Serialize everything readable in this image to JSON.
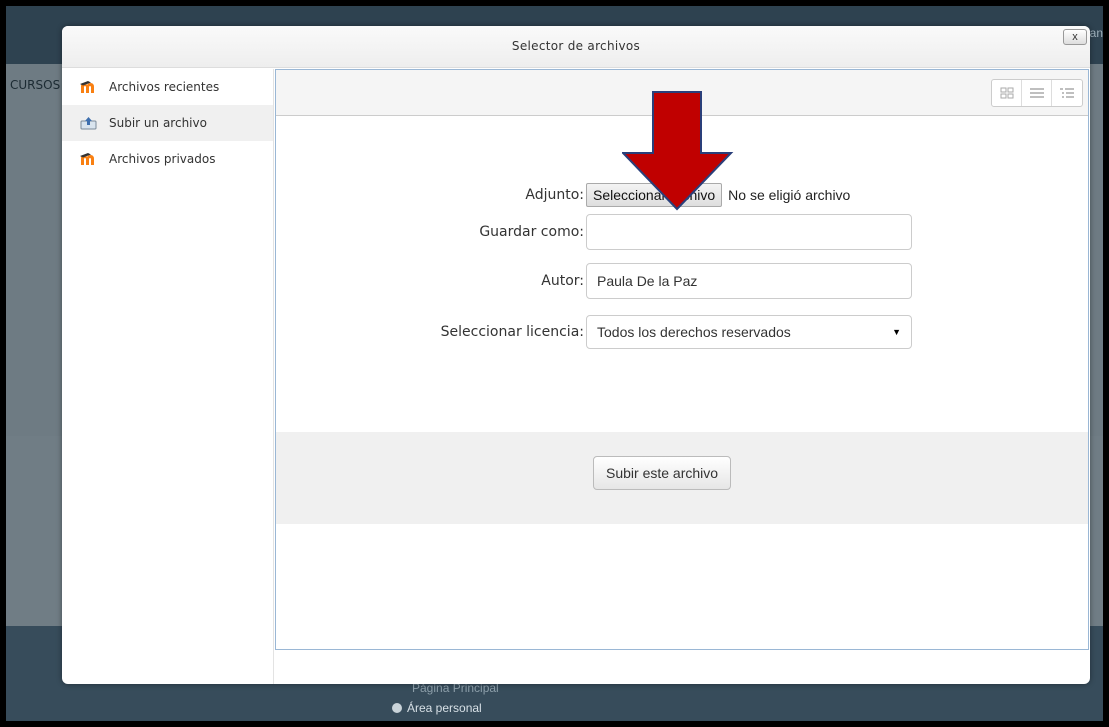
{
  "background": {
    "nav_label": "CURSOS",
    "user_fragment": "ian",
    "footer_link_1": "Página Principal",
    "footer_link_2": "Área personal"
  },
  "dialog": {
    "title": "Selector de archivos",
    "close_label": "x"
  },
  "sidebar": {
    "items": [
      {
        "label": "Archivos recientes",
        "icon": "moodle-logo-icon",
        "active": false
      },
      {
        "label": "Subir un archivo",
        "icon": "upload-icon",
        "active": true
      },
      {
        "label": "Archivos privados",
        "icon": "moodle-logo-icon",
        "active": false
      }
    ]
  },
  "toolbar": {
    "views": [
      "icons-view",
      "list-view",
      "tree-view"
    ]
  },
  "form": {
    "attachment_label": "Adjunto:",
    "file_button": "Seleccionar archivo",
    "file_status": "No se eligió archivo",
    "save_as_label": "Guardar como:",
    "save_as_value": "",
    "author_label": "Autor:",
    "author_value": "Paula De la Paz",
    "license_label": "Seleccionar licencia:",
    "license_value": "Todos los derechos reservados",
    "upload_button": "Subir este archivo"
  },
  "colors": {
    "annotation_arrow": "#c00000",
    "annotation_arrow_outline": "#2a3f7a",
    "moodle_orange": "#f98012"
  }
}
